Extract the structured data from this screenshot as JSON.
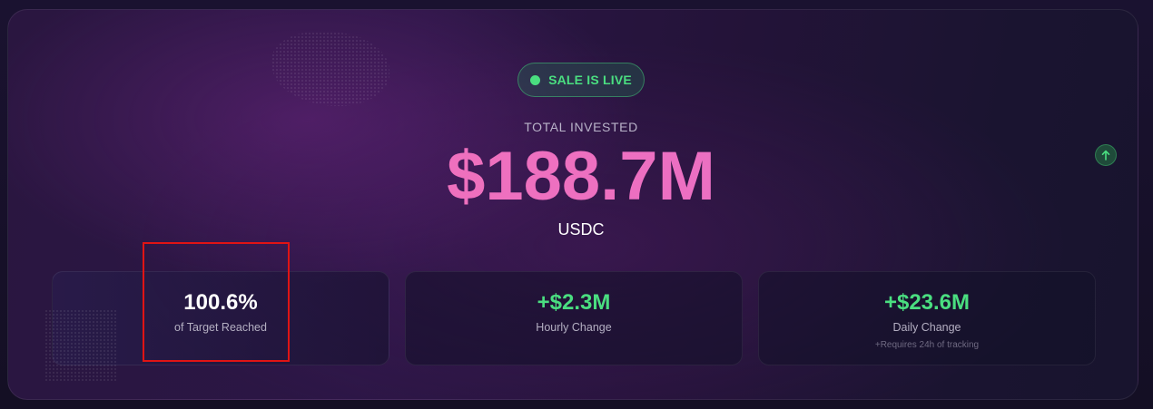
{
  "status": {
    "label": "SALE IS LIVE",
    "color": "#4ade80"
  },
  "total": {
    "label": "TOTAL INVESTED",
    "amount": "$188.7M",
    "currency": "USDC"
  },
  "stats": [
    {
      "value": "100.6%",
      "label": "of Target Reached",
      "color": "#ffffff"
    },
    {
      "value": "+$2.3M",
      "label": "Hourly Change",
      "color": "#4ade80"
    },
    {
      "value": "+$23.6M",
      "label": "Daily Change",
      "note": "+Requires 24h of tracking",
      "color": "#4ade80"
    }
  ],
  "icons": {
    "live": "live-dot-icon",
    "up": "arrow-up-icon"
  },
  "colors": {
    "accent_pink": "#f472b6",
    "highlight": "#e01414"
  }
}
